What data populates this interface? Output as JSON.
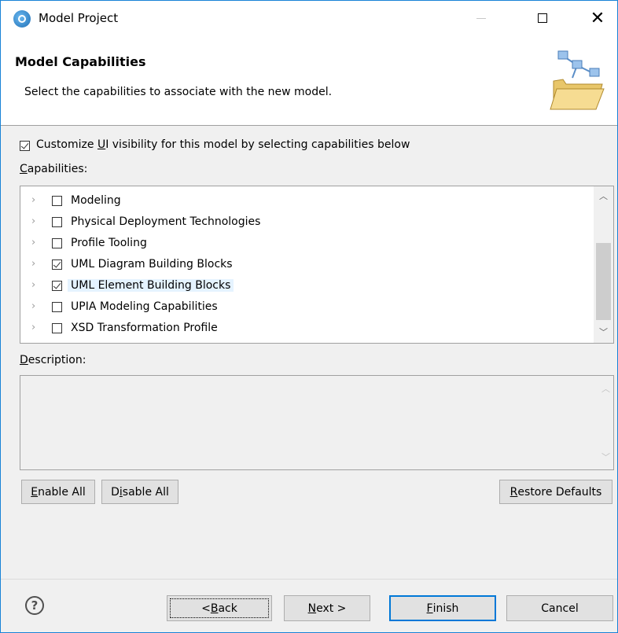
{
  "window": {
    "title": "Model Project"
  },
  "header": {
    "title": "Model Capabilities",
    "description": "Select the capabilities to associate with the new model."
  },
  "customize": {
    "label_pre": "Customize ",
    "label_u": "U",
    "label_post": "I visibility for this model by selecting capabilities below",
    "checked": true
  },
  "capabilities": {
    "label_u": "C",
    "label_rest": "apabilities:",
    "items": [
      {
        "label": "Modeling",
        "checked": false
      },
      {
        "label": "Physical Deployment Technologies",
        "checked": false
      },
      {
        "label": "Profile Tooling",
        "checked": false
      },
      {
        "label": "UML Diagram Building Blocks",
        "checked": true
      },
      {
        "label": "UML Element Building Blocks",
        "checked": true
      },
      {
        "label": "UPIA Modeling Capabilities",
        "checked": false
      },
      {
        "label": "XSD Transformation Profile",
        "checked": false
      }
    ],
    "selected_index": 4
  },
  "description": {
    "label_u": "D",
    "label_rest": "escription:",
    "text": ""
  },
  "buttons": {
    "enable_u": "E",
    "enable_rest": "nable All",
    "disable_pre": "D",
    "disable_u": "i",
    "disable_rest": "sable All",
    "restore_u": "R",
    "restore_rest": "estore Defaults",
    "back_pre": "< ",
    "back_u": "B",
    "back_rest": "ack",
    "next_u": "N",
    "next_rest": "ext >",
    "finish_u": "F",
    "finish_rest": "inish",
    "cancel": "Cancel",
    "help": "?"
  },
  "colors": {
    "accent": "#0078d7",
    "selection": "#e5f3ff"
  }
}
